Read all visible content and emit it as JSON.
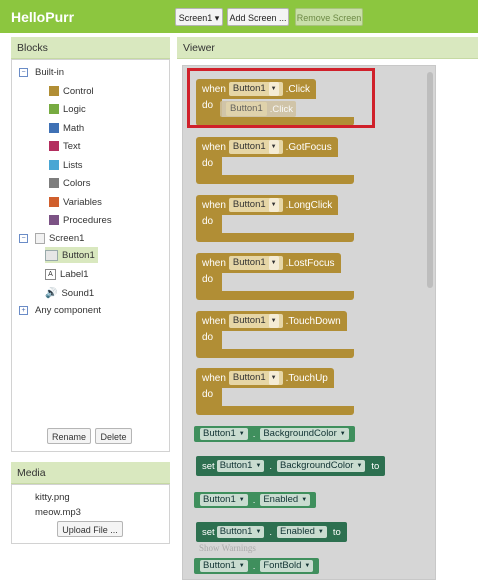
{
  "app": {
    "title": "HelloPurr"
  },
  "toolbar": {
    "screen_select": "Screen1 ▾",
    "add_screen": "Add Screen ...",
    "remove_screen": "Remove Screen"
  },
  "blocks_panel": {
    "title": "Blocks",
    "builtin": {
      "label": "Built-in",
      "items": [
        {
          "label": "Control",
          "color": "#b18e35"
        },
        {
          "label": "Logic",
          "color": "#77ab41"
        },
        {
          "label": "Math",
          "color": "#3f71b5"
        },
        {
          "label": "Text",
          "color": "#b32d5e"
        },
        {
          "label": "Lists",
          "color": "#49a6d4"
        },
        {
          "label": "Colors",
          "color": "#7d7d7d"
        },
        {
          "label": "Variables",
          "color": "#d05f2d"
        },
        {
          "label": "Procedures",
          "color": "#7c5385"
        }
      ]
    },
    "screen": {
      "label": "Screen1",
      "children": [
        "Button1",
        "Label1",
        "Sound1"
      ]
    },
    "any_component": "Any component",
    "rename": "Rename",
    "delete": "Delete"
  },
  "media_panel": {
    "title": "Media",
    "files": [
      "kitty.png",
      "meow.mp3"
    ],
    "upload": "Upload File ..."
  },
  "viewer": {
    "title": "Viewer",
    "events": [
      {
        "when": "when",
        "component": "Button1",
        "event": ".Click",
        "do": "do"
      },
      {
        "when": "when",
        "component": "Button1",
        "event": ".GotFocus",
        "do": "do"
      },
      {
        "when": "when",
        "component": "Button1",
        "event": ".LongClick",
        "do": "do"
      },
      {
        "when": "when",
        "component": "Button1",
        "event": ".LostFocus",
        "do": "do"
      },
      {
        "when": "when",
        "component": "Button1",
        "event": ".TouchDown",
        "do": "do"
      },
      {
        "when": "when",
        "component": "Button1",
        "event": ".TouchUp",
        "do": "do"
      }
    ],
    "ghost": {
      "component": "Button1",
      "event": ".Click"
    },
    "getter_bg": {
      "component": "Button1",
      "sep": ".",
      "property": "BackgroundColor"
    },
    "setter_bg": {
      "set": "set",
      "component": "Button1",
      "sep": ".",
      "property": "BackgroundColor",
      "to": "to"
    },
    "getter_en": {
      "component": "Button1",
      "sep": ".",
      "property": "Enabled"
    },
    "setter_en": {
      "set": "set",
      "component": "Button1",
      "sep": ".",
      "property": "Enabled",
      "to": "to"
    },
    "getter_fb": {
      "component": "Button1",
      "sep": ".",
      "property": "FontBold"
    },
    "show_warnings": "Show Warnings",
    "highlight_color": "#d0202a"
  }
}
